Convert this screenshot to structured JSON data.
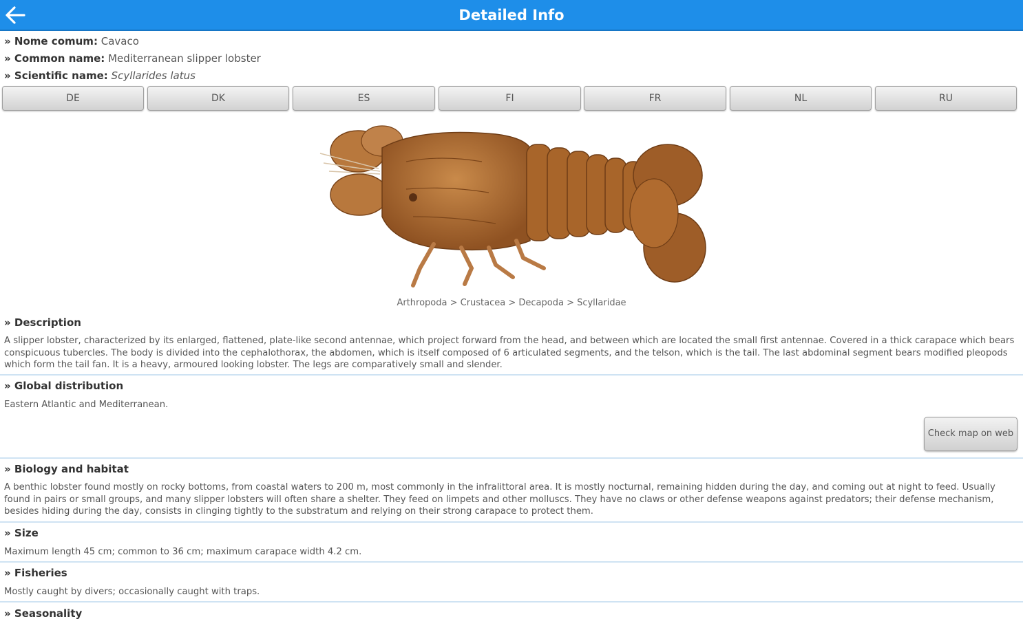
{
  "appbar": {
    "title": "Detailed Info",
    "back_icon": "arrow-left-icon"
  },
  "names": {
    "name_comum_label": "Nome comum:",
    "name_comum_value": "Cavaco",
    "common_name_label": "Common name:",
    "common_name_value": "Mediterranean slipper lobster",
    "scientific_name_label": "Scientific name:",
    "scientific_name_value": "Scyllarides latus"
  },
  "languages": [
    "DE",
    "DK",
    "ES",
    "FI",
    "FR",
    "NL",
    "RU"
  ],
  "taxonomy": "Arthropoda > Crustacea > Decapoda > Scyllaridae",
  "sections": {
    "description": {
      "title": "» Description",
      "text": "A slipper lobster, characterized by its enlarged, flattened, plate-like second antennae, which project forward from the head, and between which are located the small first antennae. Covered in a thick carapace which bears conspicuous tubercles. The body is divided into the cephalothorax, the abdomen, which is itself composed of 6 articulated segments, and the telson, which is the tail. The last abdominal segment bears modified pleopods which form the tail fan. It is a heavy, armoured looking lobster. The legs are comparatively small and slender."
    },
    "distribution": {
      "title": "» Global distribution",
      "text": "Eastern Atlantic and Mediterranean.",
      "map_button": "Check map on web"
    },
    "biology": {
      "title": "» Biology and habitat",
      "text": "A benthic lobster found mostly on rocky bottoms, from coastal waters to 200 m, most commonly in the infralittoral area. It is mostly nocturnal, remaining hidden during the day, and coming out at night to feed. Usually found in pairs or small groups, and many slipper lobsters will often share a shelter. They feed on limpets and other molluscs. They have no claws or other defense weapons against predators; their defense mechanism, besides hiding during the day, consists in clinging tightly to the substratum and relying on their strong carapace to protect them."
    },
    "size": {
      "title": "» Size",
      "text": "Maximum length 45 cm; common to 36 cm; maximum carapace width 4.2 cm."
    },
    "fisheries": {
      "title": "» Fisheries",
      "text": "Mostly caught by divers; occasionally caught with traps."
    },
    "seasonality": {
      "title": "» Seasonality"
    }
  },
  "colors": {
    "appbar": "#1e8ee9",
    "divider": "#cfe3f3",
    "lobster": "#a8652a"
  }
}
